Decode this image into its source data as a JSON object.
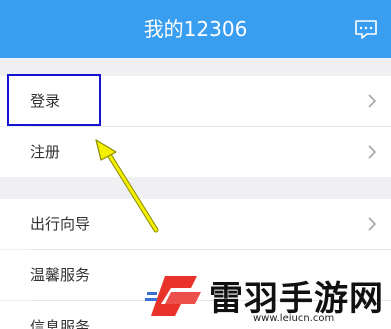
{
  "header": {
    "title": "我的12306"
  },
  "section1": {
    "login": "登录",
    "register": "注册"
  },
  "section2": {
    "travel_guide": "出行向导",
    "warm_service": "温馨服务",
    "info_service": "信息服务"
  },
  "watermark": {
    "text": "雷羽手游网",
    "url": "www.leiucn.com"
  },
  "colors": {
    "header": "#3a9ef0",
    "highlight_box": "#1414d0",
    "arrow": "#f4f000"
  }
}
